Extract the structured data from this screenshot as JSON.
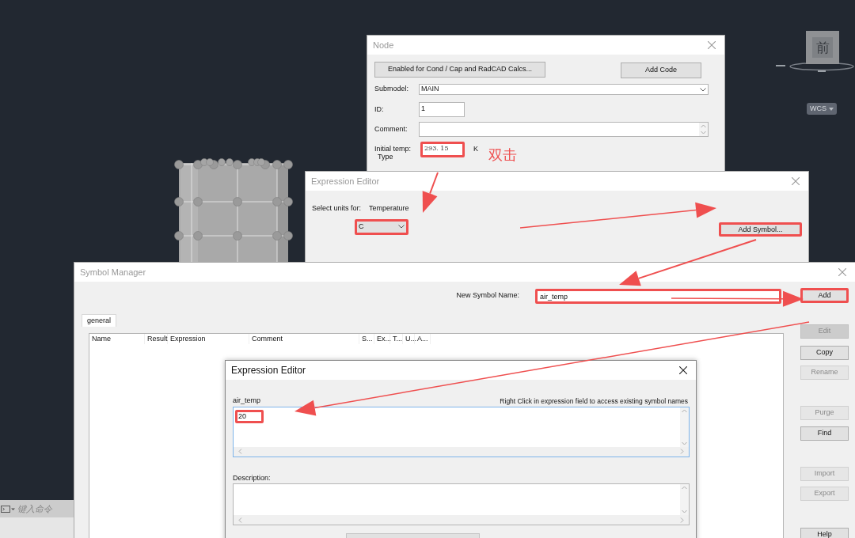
{
  "viewport": {
    "view_cube_label": "前",
    "coordinate_button": "WCS",
    "command_placeholder": "键入命令"
  },
  "node_window": {
    "title": "Node",
    "buttons": [
      "Enabled for Cond / Cap and RadCAD Calcs...",
      "Add Code"
    ],
    "submodel": {
      "label": "Submodel:",
      "value": "MAIN"
    },
    "id": {
      "label": "ID:",
      "value": "1"
    },
    "comment": {
      "label": "Comment:"
    },
    "initial_temp": {
      "label": "Initial temp:",
      "value": "293. 15",
      "unit": "K",
      "highlighted": true
    },
    "annotation": "双击",
    "group_label": "Type"
  },
  "expression_editor_units": {
    "title": "Expression Editor",
    "units_label": "Select units for:",
    "quantity": "Temperature",
    "unit": {
      "value": "C",
      "highlighted": true
    },
    "add_symbol_button": {
      "label": "Add Symbol...",
      "highlighted": true
    }
  },
  "symbol_manager": {
    "title": "Symbol Manager",
    "new_symbol_label": "New Symbol Name:",
    "new_symbol": {
      "value": "air_temp",
      "highlighted": true
    },
    "add_button": {
      "label": "Add",
      "highlighted": true
    },
    "tabs": [
      {
        "label": "general",
        "selected": true
      }
    ],
    "columns": [
      "Name",
      "Result",
      "Expression",
      "Comment",
      "S...",
      "Ex...",
      "T...",
      "U...",
      "A..."
    ],
    "side_buttons": [
      {
        "label": "Edit",
        "disabled": true
      },
      {
        "label": "Copy",
        "disabled": false
      },
      {
        "label": "Rename",
        "disabled": true
      },
      {
        "label": "Purge",
        "disabled": true
      },
      {
        "label": "Find",
        "disabled": false
      },
      {
        "label": "Import",
        "disabled": true
      },
      {
        "label": "Export",
        "disabled": true
      },
      {
        "label": "Help",
        "disabled": false
      }
    ]
  },
  "expression_editor_symbol": {
    "title": "Expression Editor",
    "symbol_name": "air_temp",
    "hint": "Right Click in expression field to access existing symbol names",
    "expression": "20",
    "highlighted": true,
    "description_label": "Description:"
  }
}
